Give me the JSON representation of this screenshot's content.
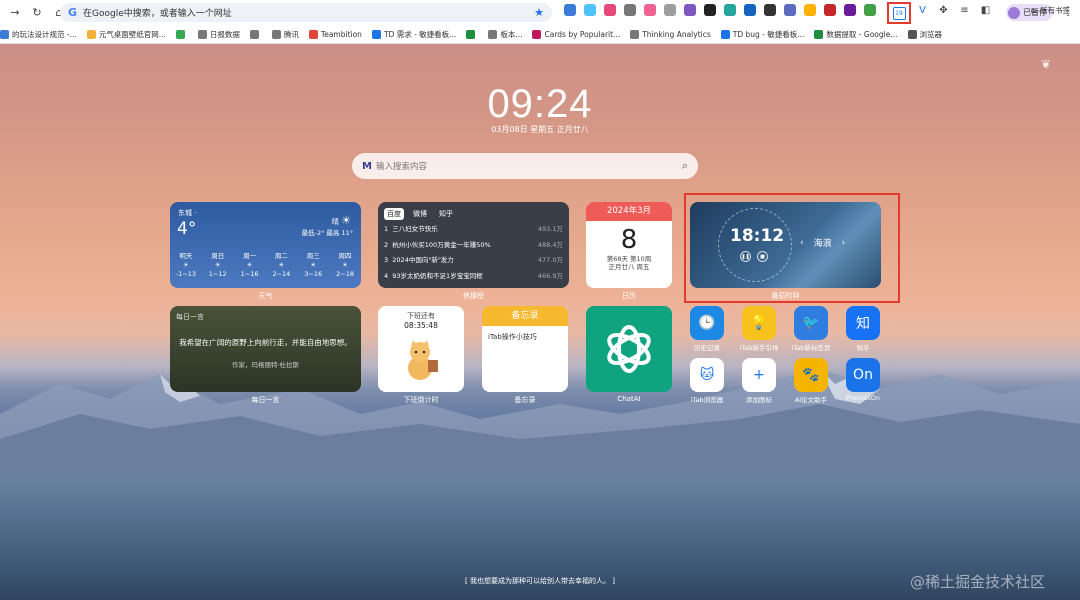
{
  "browser": {
    "omnibox_text": "在Google中搜索，或者输入一个网址",
    "profile_label": "已暂停",
    "extension_badge": "19",
    "bookmarks": [
      {
        "label": "的玩法设计规范 -...",
        "color": "#3b7cd8"
      },
      {
        "label": "元气桌面壁纸官网...",
        "color": "#f2b13a"
      },
      {
        "label": "",
        "color": "#34a853"
      },
      {
        "label": "日报数据",
        "color": "#777777"
      },
      {
        "label": "",
        "color": "#777777"
      },
      {
        "label": "腾讯",
        "color": "#777777"
      },
      {
        "label": "Teambition",
        "color": "#e2463a"
      },
      {
        "label": "TD 需求 - 敏捷看板...",
        "color": "#1a73e8"
      },
      {
        "label": "",
        "color": "#1e8e3e"
      },
      {
        "label": "板本...",
        "color": "#777777"
      },
      {
        "label": "Cards by Popularit...",
        "color": "#c2185b"
      },
      {
        "label": "Thinking Analytics",
        "color": "#777777"
      },
      {
        "label": "TD bug - 敏捷看板...",
        "color": "#1a73e8"
      },
      {
        "label": "数据提取 - Google...",
        "color": "#1e8e3e"
      },
      {
        "label": "浏览器",
        "color": "#555555"
      }
    ],
    "all_bookmarks": "所有书签"
  },
  "newtab": {
    "time": "09:24",
    "date": "03月08日 星期五 正月廿八",
    "search_logo": "M",
    "search_placeholder": "输入搜索内容",
    "quote": "[ 我也想要成为那种可以给别人带去幸福的人。 ]",
    "watermark": "@稀土掘金技术社区"
  },
  "weather": {
    "city": "东城 ·",
    "temp": "4°",
    "condition": "晴",
    "range": "最低-2° 最高 11°",
    "forecast": [
      {
        "day": "明天",
        "temp": "-1~13"
      },
      {
        "day": "周日",
        "temp": "1~12"
      },
      {
        "day": "周一",
        "temp": "1~16"
      },
      {
        "day": "周二",
        "temp": "2~14"
      },
      {
        "day": "周三",
        "temp": "3~16"
      },
      {
        "day": "周四",
        "temp": "2~18"
      }
    ],
    "caption": "天气"
  },
  "hot": {
    "tabs": [
      "百度",
      "微博",
      "知乎"
    ],
    "items": [
      {
        "rank": "1",
        "title": "三八妇女节快乐",
        "score": "493.1万"
      },
      {
        "rank": "2",
        "title": "杭州小伙买100万黄金一年赚50%",
        "score": "488.4万"
      },
      {
        "rank": "3",
        "title": "2024中国向\"新\"发力",
        "score": "477.0万"
      },
      {
        "rank": "4",
        "title": "93岁太奶奶和不足1岁宝宝同框",
        "score": "466.9万"
      }
    ],
    "caption": "热搜榜"
  },
  "calendar": {
    "month": "2024年3月",
    "day": "8",
    "week": "第68天 第10周",
    "lunar": "正月廿八 周五",
    "caption": "日历"
  },
  "sleep_clock": {
    "time": "18:12",
    "sound": "海浪",
    "caption": "番茄时钟"
  },
  "daily_quote": {
    "label": "每日一言",
    "text": "我希望在广阔的原野上向前行走，并能自由地思想。",
    "author": "作家，玛格丽特·杜拉斯",
    "caption": "每日一言"
  },
  "offwork": {
    "line1": "下班还有",
    "countdown": "08:35:48",
    "caption": "下班倒计时"
  },
  "memo": {
    "title": "备忘录",
    "note": "iTab操作小技巧",
    "caption": "备忘录"
  },
  "chatai": {
    "caption": "ChatAI"
  },
  "apps": [
    {
      "name": "history",
      "label": "历史记录",
      "glyph": "🕒",
      "bg": "#1e88e5"
    },
    {
      "name": "itab-guide",
      "label": "iTab新手引导",
      "glyph": "💡",
      "bg": "#f7c21c"
    },
    {
      "name": "itab-newtab",
      "label": "iTab新标签页",
      "glyph": "🐦",
      "bg": "#2f7de1"
    },
    {
      "name": "zhihu",
      "label": "知乎",
      "glyph": "知",
      "bg": "#1772f6"
    },
    {
      "name": "itab-browser",
      "label": "iTab浏览器",
      "glyph": "🐱",
      "bg": "#ffffff"
    },
    {
      "name": "add-icon",
      "label": "添加图标",
      "glyph": "+",
      "bg": "#ffffff"
    },
    {
      "name": "ai-writer",
      "label": "AI论文助手",
      "glyph": "🐾",
      "bg": "#f4b400"
    },
    {
      "name": "processon",
      "label": "ProcessOn",
      "glyph": "On",
      "bg": "#1a73e8"
    }
  ]
}
